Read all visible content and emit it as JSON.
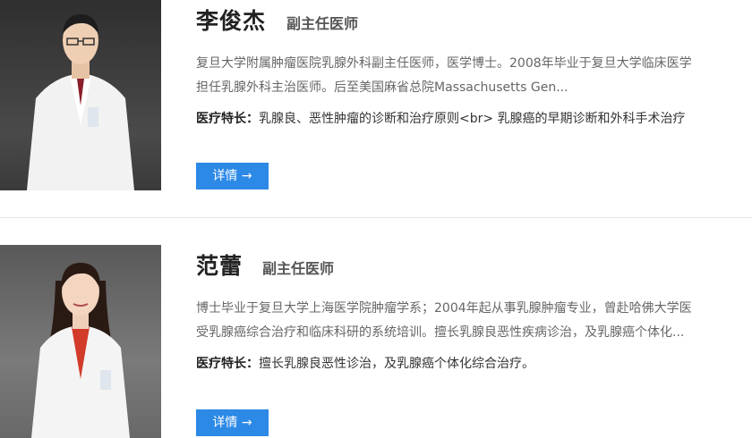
{
  "doctors": [
    {
      "name": "李俊杰",
      "title": "副主任医师",
      "desc_line1": "复旦大学附属肿瘤医院乳腺外科副主任医师，医学博士。2008年毕业于复旦大学临床医学",
      "desc_line2": "担任乳腺外科主治医师。后至美国麻省总院Massachusetts Gen...",
      "specialty_label": "医疗特长：",
      "specialty_text": "乳腺良、恶性肿瘤的诊断和治疗原则<br> 乳腺癌的早期诊断和外科手术治疗",
      "button": "详情 →"
    },
    {
      "name": "范蕾",
      "title": "副主任医师",
      "desc_line1": "博士毕业于复旦大学上海医学院肿瘤学系；2004年起从事乳腺肿瘤专业，曾赴哈佛大学医",
      "desc_line2": "受乳腺癌综合治疗和临床科研的系统培训。擅长乳腺良恶性疾病诊治，及乳腺癌个体化...",
      "specialty_label": "医疗特长：",
      "specialty_text": "擅长乳腺良恶性诊治，及乳腺癌个体化综合治疗。",
      "button": "详情 →"
    }
  ],
  "colors": {
    "accent": "#2d89e6",
    "divider": "#e5e5e5"
  }
}
